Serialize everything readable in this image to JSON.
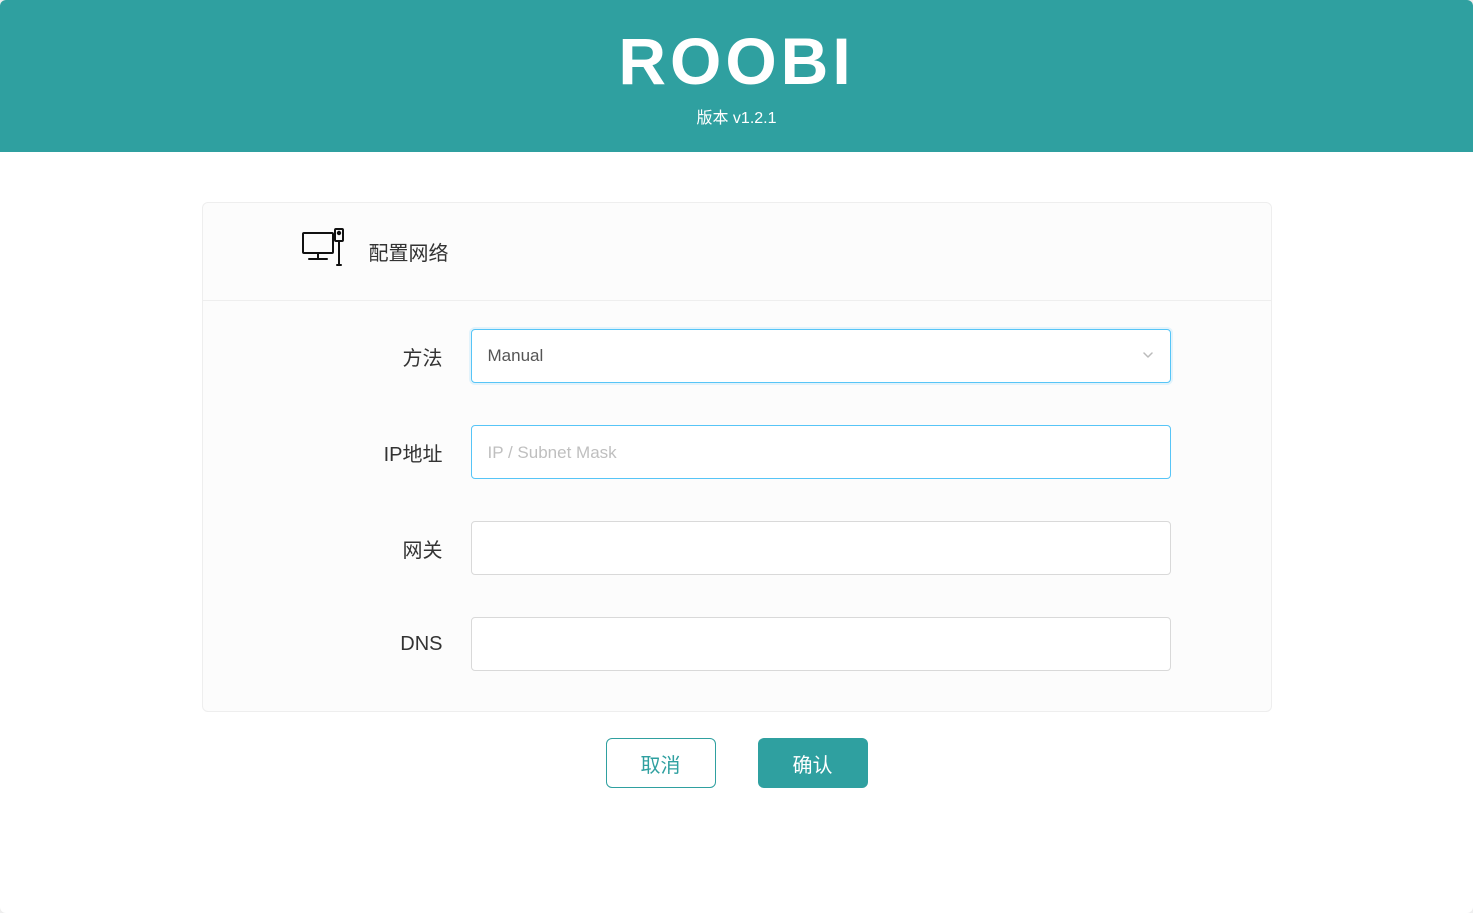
{
  "header": {
    "title": "ROOBI",
    "version_label": "版本 v1.2.1"
  },
  "card": {
    "title": "配置网络"
  },
  "form": {
    "method": {
      "label": "方法",
      "value": "Manual"
    },
    "ip": {
      "label": "IP地址",
      "placeholder": "IP / Subnet Mask",
      "value": ""
    },
    "gateway": {
      "label": "网关",
      "placeholder": "",
      "value": ""
    },
    "dns": {
      "label": "DNS",
      "placeholder": "",
      "value": ""
    }
  },
  "actions": {
    "cancel": "取消",
    "confirm": "确认"
  }
}
